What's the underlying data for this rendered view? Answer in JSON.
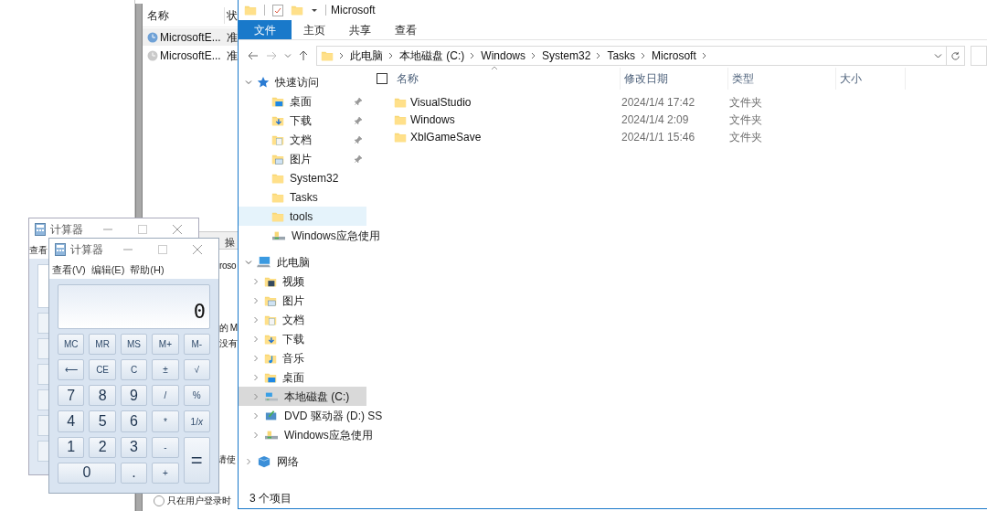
{
  "background_window": {
    "columns": [
      "名称",
      "状"
    ],
    "rows": [
      {
        "name": "MicrosoftE...",
        "status": "准",
        "selected": true
      },
      {
        "name": "MicrosoftE...",
        "status": "准",
        "selected": false
      }
    ],
    "tab": "操",
    "field": "roso",
    "lines": [
      "的 M",
      "没有",
      "请使"
    ],
    "radio": {
      "label": "只在用户登录时",
      "selected": false
    }
  },
  "calculator_back": {
    "title": "计算器",
    "menu": [
      "查看"
    ]
  },
  "calculator": {
    "title": "计算器",
    "menu": [
      "查看(V)",
      "编辑(E)",
      "帮助(H)"
    ],
    "display": "0",
    "keys": [
      {
        "label": "MC",
        "kind": "memory"
      },
      {
        "label": "MR",
        "kind": "memory"
      },
      {
        "label": "MS",
        "kind": "memory"
      },
      {
        "label": "M+",
        "kind": "memory"
      },
      {
        "label": "M-",
        "kind": "memory"
      },
      {
        "label": "⟵",
        "kind": "op"
      },
      {
        "label": "CE",
        "kind": "op"
      },
      {
        "label": "C",
        "kind": "op"
      },
      {
        "label": "±",
        "kind": "op"
      },
      {
        "label": "√",
        "kind": "op"
      },
      {
        "label": "7",
        "kind": "digit"
      },
      {
        "label": "8",
        "kind": "digit"
      },
      {
        "label": "9",
        "kind": "digit"
      },
      {
        "label": "/",
        "kind": "op"
      },
      {
        "label": "%",
        "kind": "op"
      },
      {
        "label": "4",
        "kind": "digit"
      },
      {
        "label": "5",
        "kind": "digit"
      },
      {
        "label": "6",
        "kind": "digit"
      },
      {
        "label": "*",
        "kind": "op"
      },
      {
        "label": "1/*x*",
        "kind": "op"
      },
      {
        "label": "1",
        "kind": "digit"
      },
      {
        "label": "2",
        "kind": "digit"
      },
      {
        "label": "3",
        "kind": "digit"
      },
      {
        "label": "-",
        "kind": "op"
      },
      {
        "label": "=",
        "kind": "tall"
      },
      {
        "label": "0",
        "kind": "wide"
      },
      {
        "label": ".",
        "kind": "digit"
      },
      {
        "label": "+",
        "kind": "op"
      }
    ]
  },
  "explorer": {
    "title": "Microsoft",
    "ribbon_tabs": [
      {
        "label": "文件",
        "selected": true
      },
      {
        "label": "主页",
        "selected": false
      },
      {
        "label": "共享",
        "selected": false
      },
      {
        "label": "查看",
        "selected": false
      }
    ],
    "breadcrumb": [
      "此电脑",
      "本地磁盘 (C:)",
      "Windows",
      "System32",
      "Tasks",
      "Microsoft"
    ],
    "select_all": {
      "checked": false
    },
    "columns": [
      "名称",
      "修改日期",
      "类型",
      "大小"
    ],
    "files": [
      {
        "name": "VisualStudio",
        "modified": "2024/1/4 17:42",
        "type": "文件夹"
      },
      {
        "name": "Windows",
        "modified": "2024/1/4 2:09",
        "type": "文件夹"
      },
      {
        "name": "XblGameSave",
        "modified": "2024/1/1 15:46",
        "type": "文件夹"
      }
    ],
    "nav": [
      {
        "label": "快速访问",
        "kind": "star",
        "expanded": true,
        "selected": false,
        "hovered": false,
        "children": [
          {
            "label": "桌面",
            "kind": "desktop",
            "pinned": true,
            "selected": false,
            "hovered": false
          },
          {
            "label": "下载",
            "kind": "download",
            "pinned": true,
            "selected": false,
            "hovered": false
          },
          {
            "label": "文档",
            "kind": "document",
            "pinned": true,
            "selected": false,
            "hovered": false
          },
          {
            "label": "图片",
            "kind": "picture",
            "pinned": true,
            "selected": false,
            "hovered": false
          },
          {
            "label": "System32",
            "kind": "folder",
            "pinned": false,
            "selected": false,
            "hovered": false
          },
          {
            "label": "Tasks",
            "kind": "folder",
            "pinned": false,
            "selected": false,
            "hovered": false
          },
          {
            "label": "tools",
            "kind": "folder",
            "pinned": false,
            "selected": false,
            "hovered": true
          },
          {
            "label": "Windows应急使用",
            "kind": "usb",
            "pinned": false,
            "selected": false,
            "hovered": false
          }
        ]
      },
      {
        "label": "此电脑",
        "kind": "pc",
        "expanded": true,
        "selected": false,
        "hovered": false,
        "children": [
          {
            "label": "视频",
            "kind": "video",
            "expanded": false,
            "selected": false,
            "hovered": false
          },
          {
            "label": "图片",
            "kind": "picture",
            "expanded": false,
            "selected": false,
            "hovered": false
          },
          {
            "label": "文档",
            "kind": "document",
            "expanded": false,
            "selected": false,
            "hovered": false
          },
          {
            "label": "下载",
            "kind": "download",
            "expanded": false,
            "selected": false,
            "hovered": false
          },
          {
            "label": "音乐",
            "kind": "music",
            "expanded": false,
            "selected": false,
            "hovered": false
          },
          {
            "label": "桌面",
            "kind": "desktop",
            "expanded": false,
            "selected": false,
            "hovered": false
          },
          {
            "label": "本地磁盘 (C:)",
            "kind": "drive",
            "expanded": false,
            "selected": true,
            "hovered": false
          },
          {
            "label": "DVD 驱动器 (D:) SS",
            "kind": "dvd",
            "expanded": false,
            "selected": false,
            "hovered": false
          },
          {
            "label": "Windows应急使用",
            "kind": "usb",
            "expanded": false,
            "selected": false,
            "hovered": false
          }
        ]
      },
      {
        "label": "网络",
        "kind": "network",
        "expanded": false,
        "selected": false,
        "hovered": false
      }
    ],
    "status": "3 个项目"
  }
}
